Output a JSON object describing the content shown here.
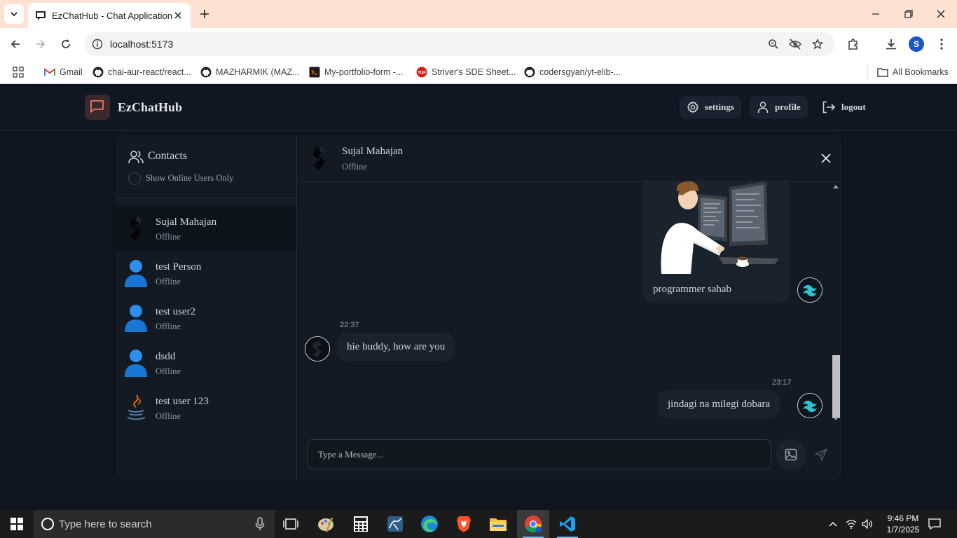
{
  "browser": {
    "tab_title": "EzChatHub - Chat Application",
    "url": "localhost:5173",
    "avatar_letter": "S",
    "bookmarks": [
      {
        "label": "Gmail",
        "icon": "gmail-icon"
      },
      {
        "label": "chai-aur-react/react...",
        "icon": "github-icon"
      },
      {
        "label": "MAZHARMIK (MAZ...",
        "icon": "github-icon"
      },
      {
        "label": "My-portfolio-form -...",
        "icon": "replit-icon"
      },
      {
        "label": "Striver's SDE Sheet...",
        "icon": "tuf-icon"
      },
      {
        "label": "codersgyan/yt-elib-...",
        "icon": "github-icon"
      }
    ],
    "all_bookmarks": "All Bookmarks"
  },
  "app": {
    "brand": "EzChatHub",
    "nav": {
      "settings": "settings",
      "profile": "profile",
      "logout": "logout"
    },
    "colors": {
      "accent": "#e8786b",
      "background": "#0f151e",
      "panel": "#131a24",
      "bubble": "#1a222d"
    }
  },
  "sidebar": {
    "title": "Contacts",
    "online_filter": "Show Online Users Only",
    "contacts": [
      {
        "name": "Sujal Mahajan",
        "status": "Offline",
        "avatar": "sujal-logo-avatar",
        "active": true
      },
      {
        "name": "test Person",
        "status": "Offline",
        "avatar": "default-user-avatar"
      },
      {
        "name": "test user2",
        "status": "Offline",
        "avatar": "default-user-avatar"
      },
      {
        "name": "dsdd",
        "status": "Offline",
        "avatar": "default-user-avatar"
      },
      {
        "name": "test user 123",
        "status": "Offline",
        "avatar": "java-logo-avatar"
      }
    ]
  },
  "chat": {
    "contact_name": "Sujal Mahajan",
    "contact_status": "Offline",
    "messages": [
      {
        "from": "me",
        "image": "programmer-illustration",
        "text": "programmer sahab"
      },
      {
        "from": "them",
        "time": "22:37",
        "text": "hie buddy, how are you"
      },
      {
        "from": "me",
        "time": "23:17",
        "text": "jindagi na milegi dobara"
      }
    ],
    "input_placeholder": "Type a Message..."
  },
  "taskbar": {
    "search_placeholder": "Type here to search",
    "time": "9:46 PM",
    "date": "1/7/2025"
  }
}
